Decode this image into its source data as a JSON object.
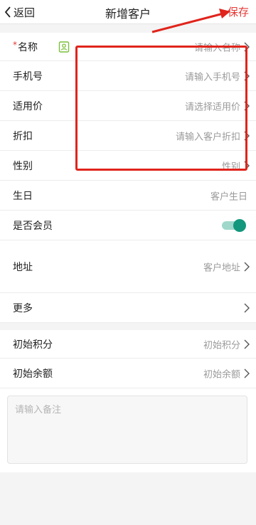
{
  "nav": {
    "back_label": "返回",
    "title": "新增客户",
    "save_label": "保存"
  },
  "form": {
    "name": {
      "required_mark": "*",
      "label": "名称",
      "placeholder": "请输入名称"
    },
    "phone": {
      "label": "手机号",
      "placeholder": "请输入手机号"
    },
    "price": {
      "label": "适用价",
      "placeholder": "请选择适用价"
    },
    "discount": {
      "label": "折扣",
      "placeholder": "请输入客户折扣"
    },
    "gender": {
      "label": "性别",
      "placeholder": "性别"
    },
    "birthday": {
      "label": "生日",
      "placeholder": "客户生日"
    },
    "member": {
      "label": "是否会员",
      "enabled": true
    },
    "address": {
      "label": "地址",
      "placeholder": "客户地址"
    },
    "more": {
      "label": "更多"
    },
    "initial_points": {
      "label": "初始积分",
      "placeholder": "初始积分"
    },
    "initial_balance": {
      "label": "初始余额",
      "placeholder": "初始余额"
    },
    "remark": {
      "placeholder": "请输入备注"
    }
  },
  "colors": {
    "accent_red": "#e53935",
    "toggle_on": "#13977d",
    "contact_icon": "#7cbf3a"
  }
}
